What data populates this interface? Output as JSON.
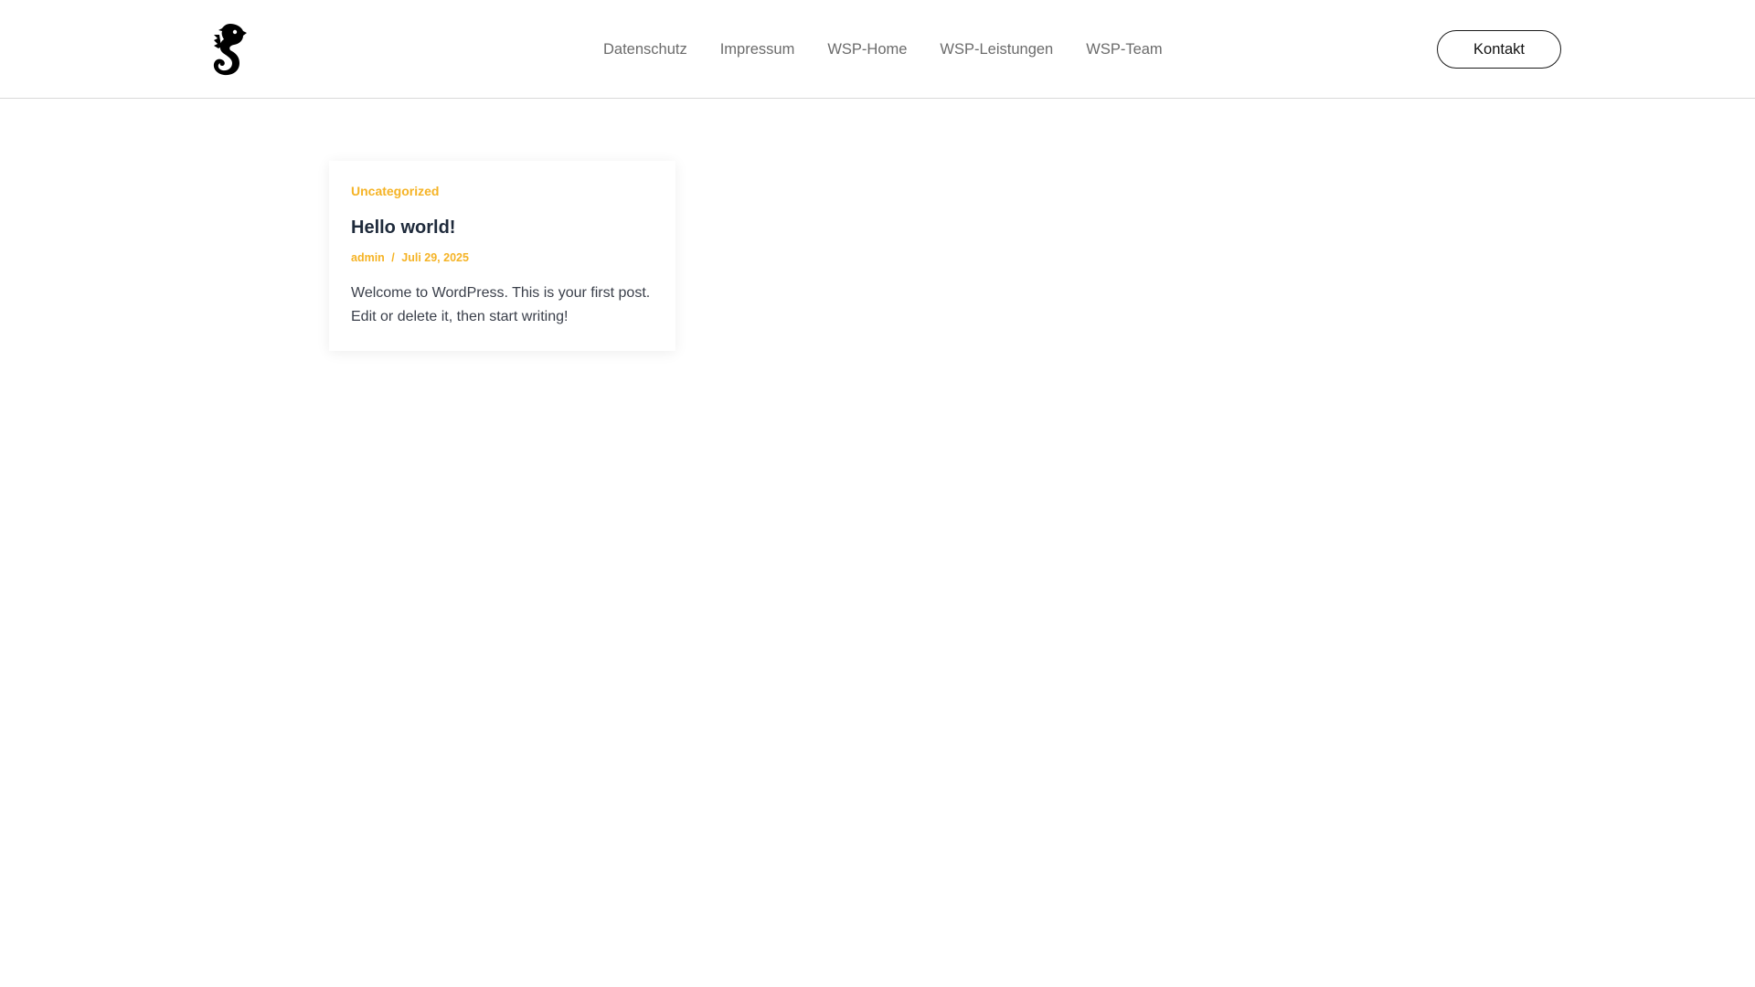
{
  "header": {
    "logo_icon": "seahorse-logo-icon",
    "nav": {
      "items": [
        {
          "label": "Datenschutz"
        },
        {
          "label": "Impressum"
        },
        {
          "label": "WSP-Home"
        },
        {
          "label": "WSP-Leistungen"
        },
        {
          "label": "WSP-Team"
        }
      ]
    },
    "kontakt_label": "Kontakt"
  },
  "post": {
    "category": "Uncategorized",
    "title": "Hello world!",
    "author": "admin",
    "separator": "/",
    "date": "Juli 29, 2025",
    "excerpt": "Welcome to WordPress. This is your first post. Edit or delete it, then start writing!"
  },
  "colors": {
    "accent": "#f5b325",
    "title": "#1e2a3b",
    "nav_text": "#6b6b6b",
    "border": "#d9d9d9"
  }
}
